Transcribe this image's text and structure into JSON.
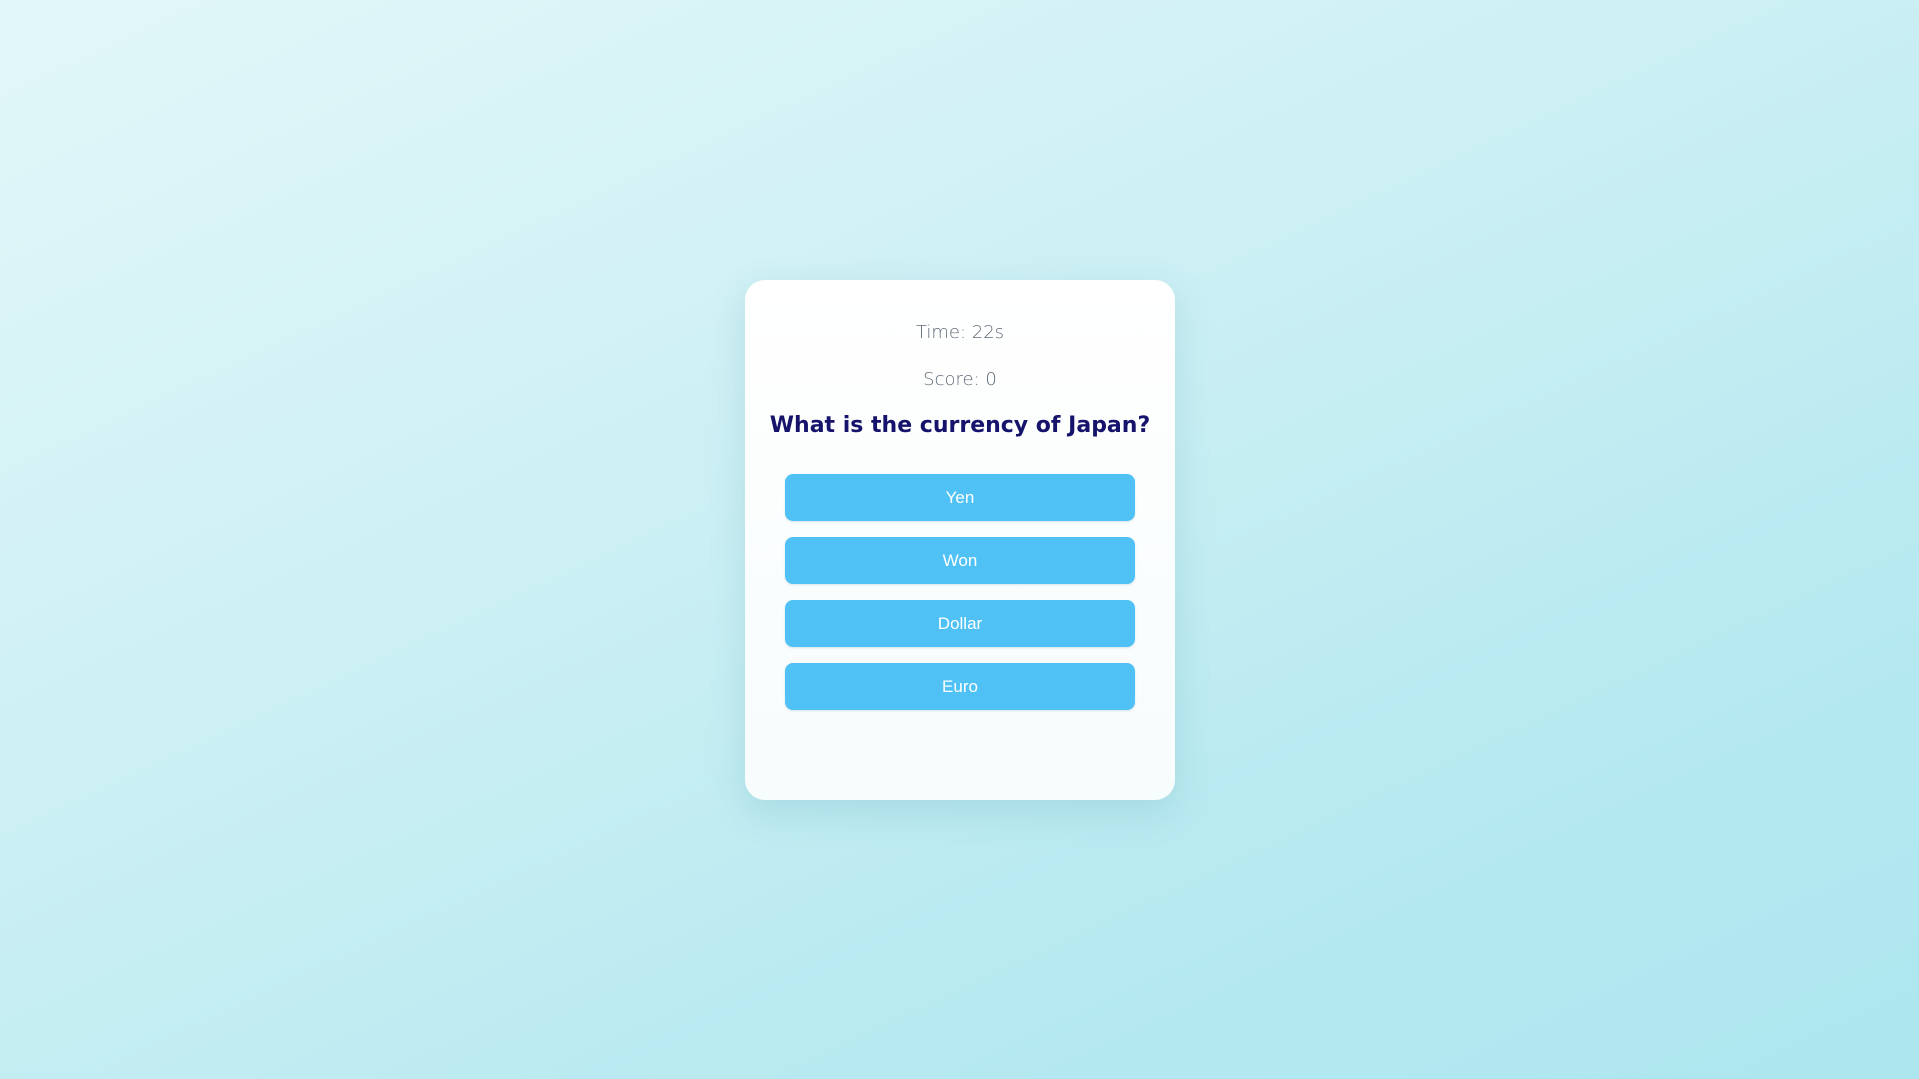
{
  "quiz": {
    "timer": "Time: 22s",
    "score": "Score: 0",
    "question": "What is the currency of Japan?",
    "options": [
      "Yen",
      "Won",
      "Dollar",
      "Euro"
    ]
  },
  "colors": {
    "accent": "#4fc1f5",
    "question_text": "#15136b",
    "stat_text": "#5f6b78",
    "card_background": "#ffffff"
  }
}
